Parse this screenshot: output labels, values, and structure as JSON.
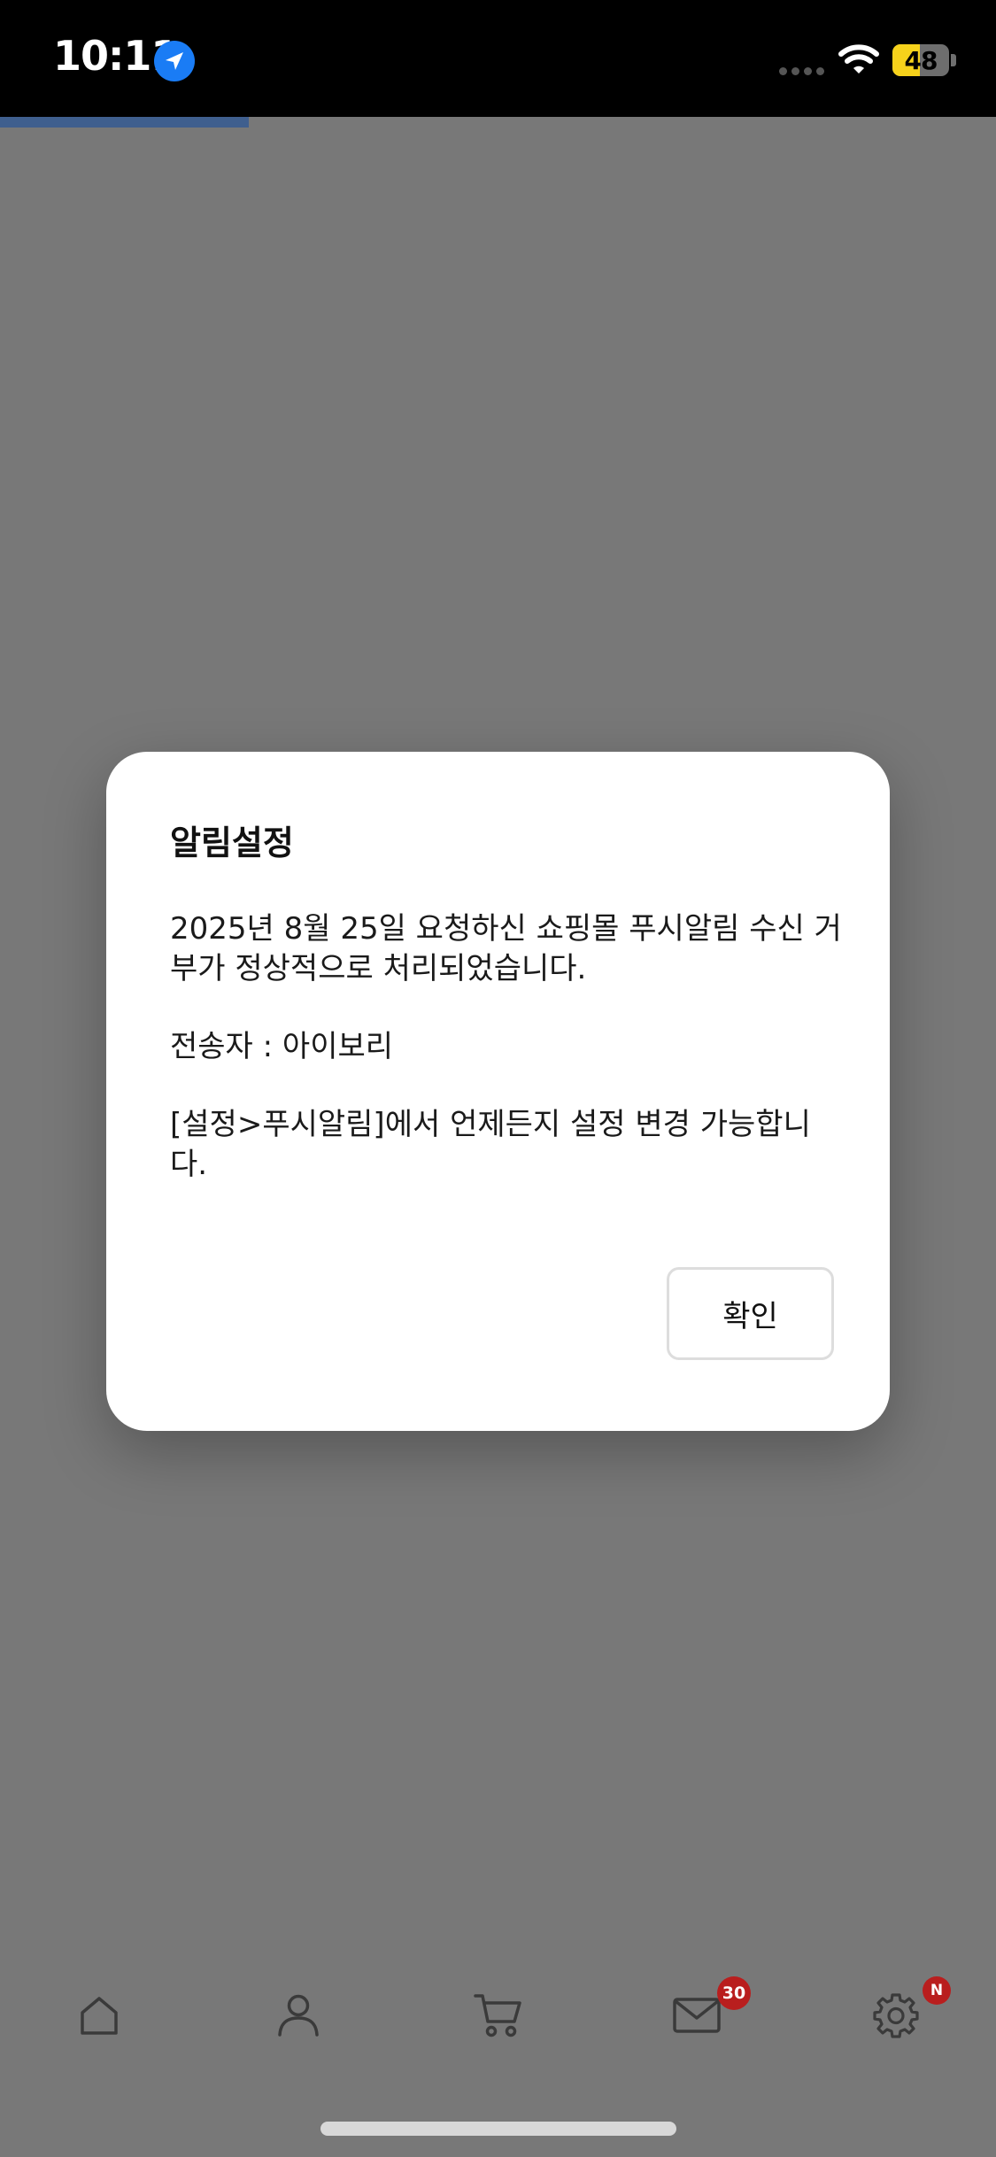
{
  "status_bar": {
    "time": "10:11",
    "battery_level": "48",
    "battery_fraction": 0.48
  },
  "page_loading": {
    "progress_fraction": 0.25
  },
  "dialog": {
    "title": "알림설정",
    "message_line1": "2025년 8월 25일 요청하신 쇼핑몰 푸시알림 수신 거부가 정상적으로 처리되었습니다.",
    "sender_line": "전송자 : 아이보리",
    "settings_hint": "[설정>푸시알림]에서 언제든지 설정 변경 가능합니다.",
    "confirm_label": "확인"
  },
  "bottom_nav": {
    "items": [
      {
        "icon": "home-icon"
      },
      {
        "icon": "user-icon"
      },
      {
        "icon": "cart-icon"
      },
      {
        "icon": "mail-icon",
        "badge": "30"
      },
      {
        "icon": "gear-icon",
        "badge": "N"
      }
    ]
  },
  "colors": {
    "overlay": "#787878",
    "badge": "#b91e1e",
    "progress": "#3f5f8e",
    "battery_fill": "#f6d21b",
    "location": "#1a7cf5"
  }
}
